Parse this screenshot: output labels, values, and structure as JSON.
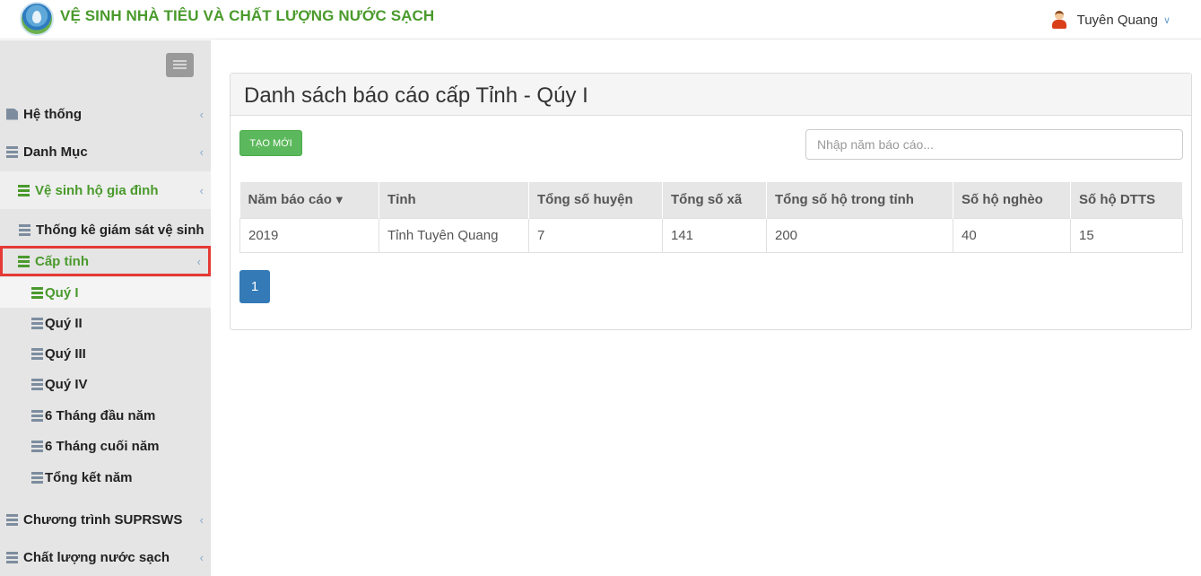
{
  "header": {
    "title": "VỆ SINH NHÀ TIÊU VÀ CHẤT LƯỢNG NƯỚC SẠCH",
    "user_name": "Tuyên Quang"
  },
  "sidebar": {
    "items": [
      {
        "label": "Hệ thống",
        "icon": "file-icon"
      },
      {
        "label": "Danh Mục",
        "icon": "list-icon"
      },
      {
        "label": "Vệ sinh hộ gia đình",
        "icon": "list-icon"
      },
      {
        "label": "Thống kê giám sát vệ sinh",
        "icon": "list-icon"
      },
      {
        "label": "Cấp tỉnh",
        "icon": "list-icon"
      },
      {
        "label": "Quý I",
        "icon": "list-icon"
      },
      {
        "label": "Quý II",
        "icon": "list-icon"
      },
      {
        "label": "Quý III",
        "icon": "list-icon"
      },
      {
        "label": "Quý IV",
        "icon": "list-icon"
      },
      {
        "label": "6 Tháng đầu năm",
        "icon": "list-icon"
      },
      {
        "label": "6 Tháng cuối năm",
        "icon": "list-icon"
      },
      {
        "label": "Tổng kết năm",
        "icon": "list-icon"
      },
      {
        "label": "Chương trình SUPRSWS",
        "icon": "list-icon"
      },
      {
        "label": "Chất lượng nước sạch",
        "icon": "list-icon"
      }
    ]
  },
  "main": {
    "panel_title": "Danh sách báo cáo cấp Tỉnh - Qúy I",
    "new_button": "TẠO MỚI",
    "search_placeholder": "Nhập năm báo cáo...",
    "columns": [
      "Năm báo cáo",
      "Tỉnh",
      "Tổng số huyện",
      "Tổng số xã",
      "Tổng số hộ trong tỉnh",
      "Số hộ nghèo",
      "Số hộ DTTS"
    ],
    "rows": [
      [
        "2019",
        "Tỉnh Tuyên Quang",
        "7",
        "141",
        "200",
        "40",
        "15"
      ]
    ],
    "page": "1"
  },
  "colors": {
    "brand_green": "#4a9a2c",
    "button_green": "#5cb85c",
    "page_blue": "#337ab7",
    "highlight_red": "#e53935"
  }
}
